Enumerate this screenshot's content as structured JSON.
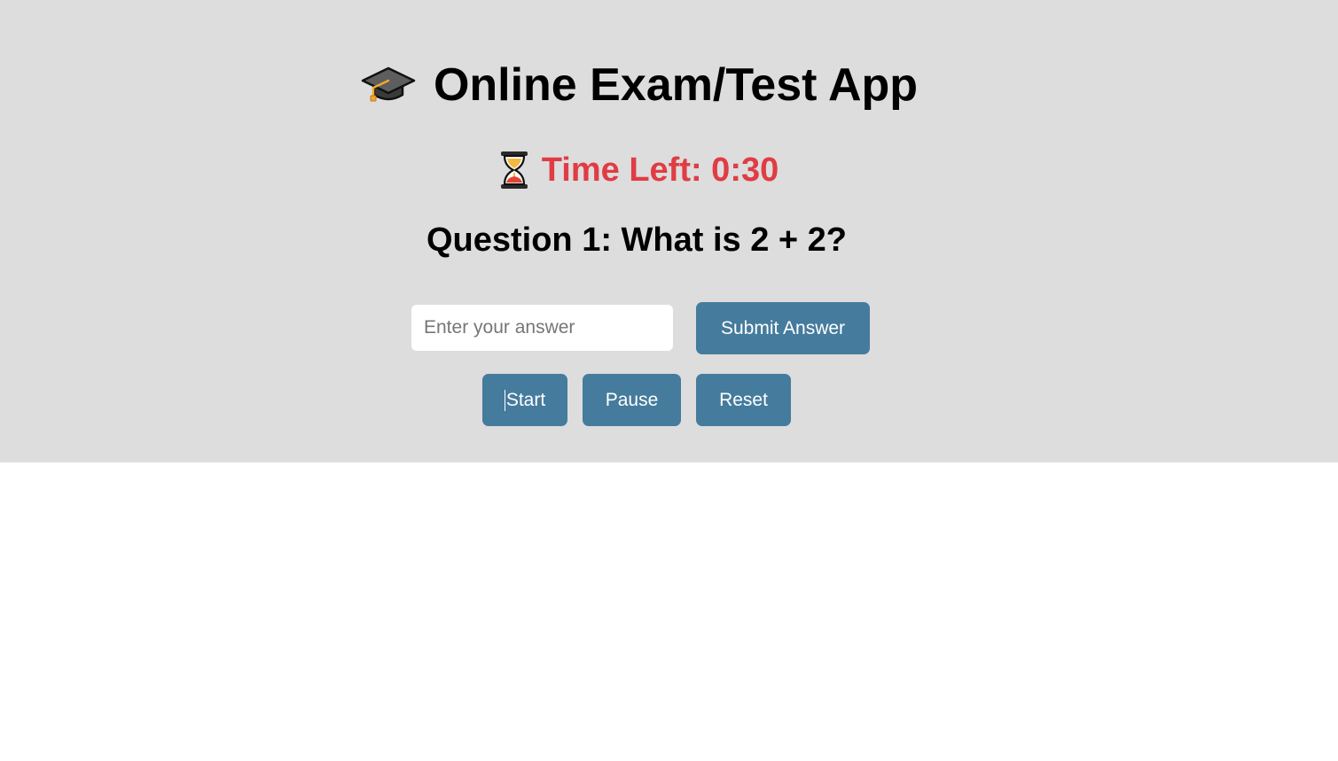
{
  "app": {
    "title": "Online Exam/Test App",
    "title_icon": "graduation-cap-icon",
    "background_color": "#dddddd"
  },
  "timer": {
    "icon": "hourglass-icon",
    "text": "Time Left: 0:30",
    "color": "#e03c44"
  },
  "question": {
    "text": "Question 1: What is 2 + 2?"
  },
  "answer": {
    "value": "",
    "placeholder": "Enter your answer"
  },
  "buttons": {
    "color": "#457b9d",
    "submit_label": "Submit Answer",
    "start_label": "Start",
    "pause_label": "Pause",
    "reset_label": "Reset"
  }
}
